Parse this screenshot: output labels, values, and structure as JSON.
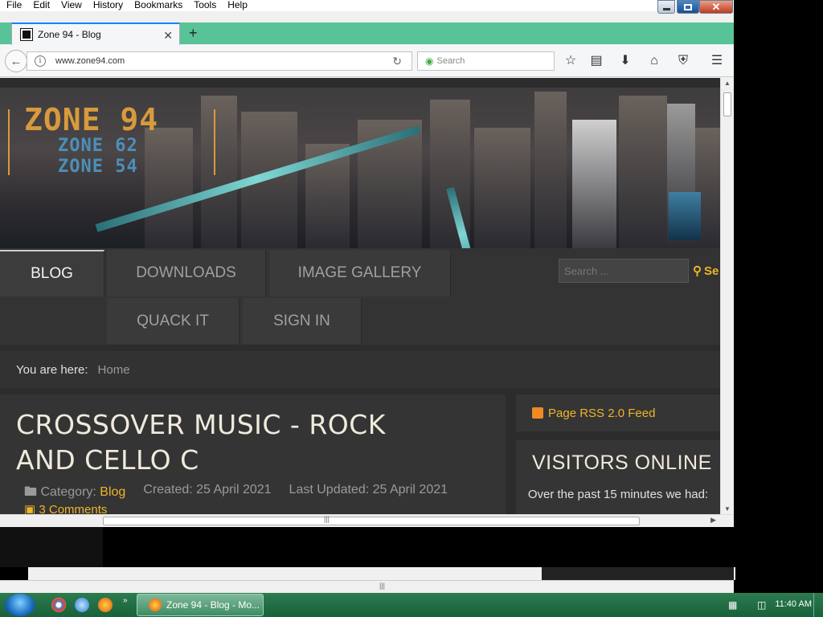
{
  "menubar": {
    "items": [
      "File",
      "Edit",
      "View",
      "History",
      "Bookmarks",
      "Tools",
      "Help"
    ]
  },
  "tab": {
    "title": "Zone 94 - Blog",
    "new_tab": "+"
  },
  "navbar": {
    "url": "www.zone94.com",
    "search_placeholder": "Search"
  },
  "banner": {
    "logo_main": "ZONE 94",
    "logo_sub1": "ZONE 62",
    "logo_sub2": "ZONE 54"
  },
  "site_nav": {
    "items": [
      "BLOG",
      "DOWNLOADS",
      "IMAGE GALLERY",
      "QUACK IT",
      "SIGN IN"
    ],
    "search_placeholder": "Search ...",
    "search_button": "Se"
  },
  "breadcrumb": {
    "label": "You are here:",
    "home": "Home"
  },
  "article": {
    "title": "CROSSOVER MUSIC - ROCK AND CELLO C",
    "category_label": "Category:",
    "category_value": "Blog",
    "created": "Created: 25 April 2021",
    "updated": "Last Updated: 25 April 2021",
    "comments": "3 Comments"
  },
  "sidebar": {
    "rss": "Page RSS 2.0 Feed",
    "visitors_title": "VISITORS ONLINE",
    "visitors_text": "Over the past 15 minutes we had:"
  },
  "taskbar": {
    "window": "Zone 94 - Blog - Mo...",
    "clock": "11:40 AM"
  },
  "colors": {
    "accent": "#f0b429",
    "tabstrip": "#57c396",
    "taskbar": "#18613a"
  }
}
